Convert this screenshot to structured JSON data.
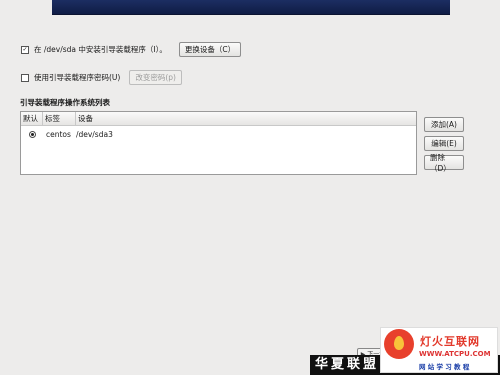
{
  "install_on_device": {
    "checked": true,
    "label": "在 /dev/sda 中安装引导装载程序（I）。",
    "change_device_button": "更换设备（C）"
  },
  "use_password": {
    "checked": false,
    "label": "使用引导装载程序密码(U)",
    "change_password_button": "改变密码(p)"
  },
  "os_list": {
    "title": "引导装载程序操作系统列表",
    "columns": [
      "默认",
      "标签",
      "设备"
    ],
    "rows": [
      {
        "default": true,
        "label": "centos",
        "device": "/dev/sda3"
      }
    ]
  },
  "side_buttons": {
    "add": "添加(A)",
    "edit": "编辑(E)",
    "delete": "删除（D）"
  },
  "footer": {
    "next_button": "▶ 下一步",
    "watermark": "华夏联盟",
    "logo_title": "灯火互联网",
    "logo_url": "WWW.ATCPU.COM",
    "logo_sub": "网 站 学 习 教 程"
  },
  "colors": {
    "banner": "#1c2e62",
    "background": "#edeceb",
    "logo_red": "#e2382a",
    "logo_blue": "#1b3fa8"
  }
}
